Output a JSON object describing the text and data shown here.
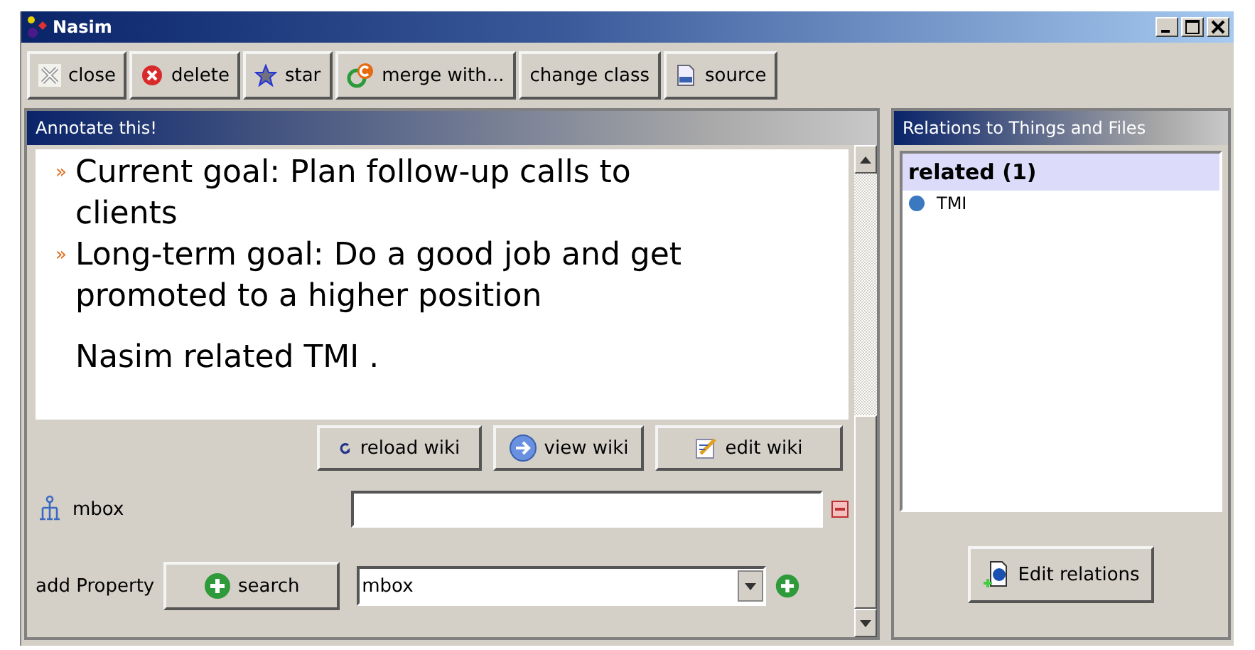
{
  "window": {
    "title": "Nasim"
  },
  "toolbar": [
    {
      "kind": "close",
      "label": "close"
    },
    {
      "kind": "delete",
      "label": "delete"
    },
    {
      "kind": "star",
      "label": "star"
    },
    {
      "kind": "merge",
      "label": "merge with..."
    },
    {
      "kind": "plain",
      "label": "change class"
    },
    {
      "kind": "source",
      "label": "source"
    }
  ],
  "annotate": {
    "title": "Annotate this!",
    "bullets": [
      {
        "mark": "»",
        "text": "Current goal: Plan follow-up calls to clients"
      },
      {
        "mark": "»",
        "text": "Long-term goal: Do a good job and get promoted to a higher position"
      }
    ],
    "sentence": "Nasim related TMI .",
    "wiki_buttons": [
      {
        "kind": "reload",
        "label": "reload wiki"
      },
      {
        "kind": "view",
        "label": "view wiki"
      },
      {
        "kind": "edit",
        "label": "edit wiki"
      }
    ],
    "property": {
      "label": "mbox"
    },
    "add_property": {
      "label": "add Property",
      "search": "search",
      "value": "mbox"
    }
  },
  "relations": {
    "title": "Relations to Things and Files",
    "group": "related (1)",
    "items": [
      {
        "label": "TMI",
        "color": "#3a78c0"
      }
    ],
    "button": "Edit relations"
  }
}
